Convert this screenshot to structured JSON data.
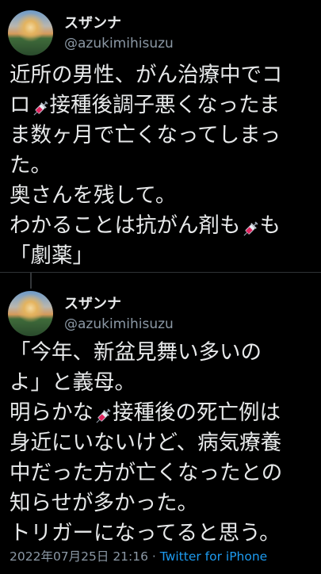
{
  "tweets": [
    {
      "display_name": "スザンナ",
      "handle": "@azukimihisuzu",
      "lines": [
        [
          "近所の男性、がん治療中でコ"
        ],
        [
          "ロ",
          "syringe",
          "接種後調子悪くなったま"
        ],
        [
          "ま数ヶ月で亡くなってしまっ"
        ],
        [
          "た。"
        ],
        [
          "奥さんを残して。"
        ],
        [
          "わかることは抗がん剤も",
          "syringe",
          "も"
        ],
        [
          "「劇薬」"
        ]
      ]
    },
    {
      "display_name": "スザンナ",
      "handle": "@azukimihisuzu",
      "lines": [
        [
          "「今年、新盆見舞い多いの"
        ],
        [
          "よ」と義母。"
        ],
        [
          "明らかな",
          "syringe",
          "接種後の死亡例は"
        ],
        [
          "身近にいないけど、病気療養"
        ],
        [
          "中だった方が亡くなったとの"
        ],
        [
          "知らせが多かった。"
        ],
        [
          "トリガーになってると思う。"
        ]
      ]
    }
  ],
  "meta": {
    "timestamp": "2022年07月25日 21:16",
    "separator": " · ",
    "source": "Twitter for iPhone"
  },
  "icons": {
    "inline_emoji": "syringe-icon"
  },
  "colors": {
    "background": "#000000",
    "text": "#e7e9ea",
    "muted": "#8b98a5",
    "link": "#1d9bf0"
  }
}
